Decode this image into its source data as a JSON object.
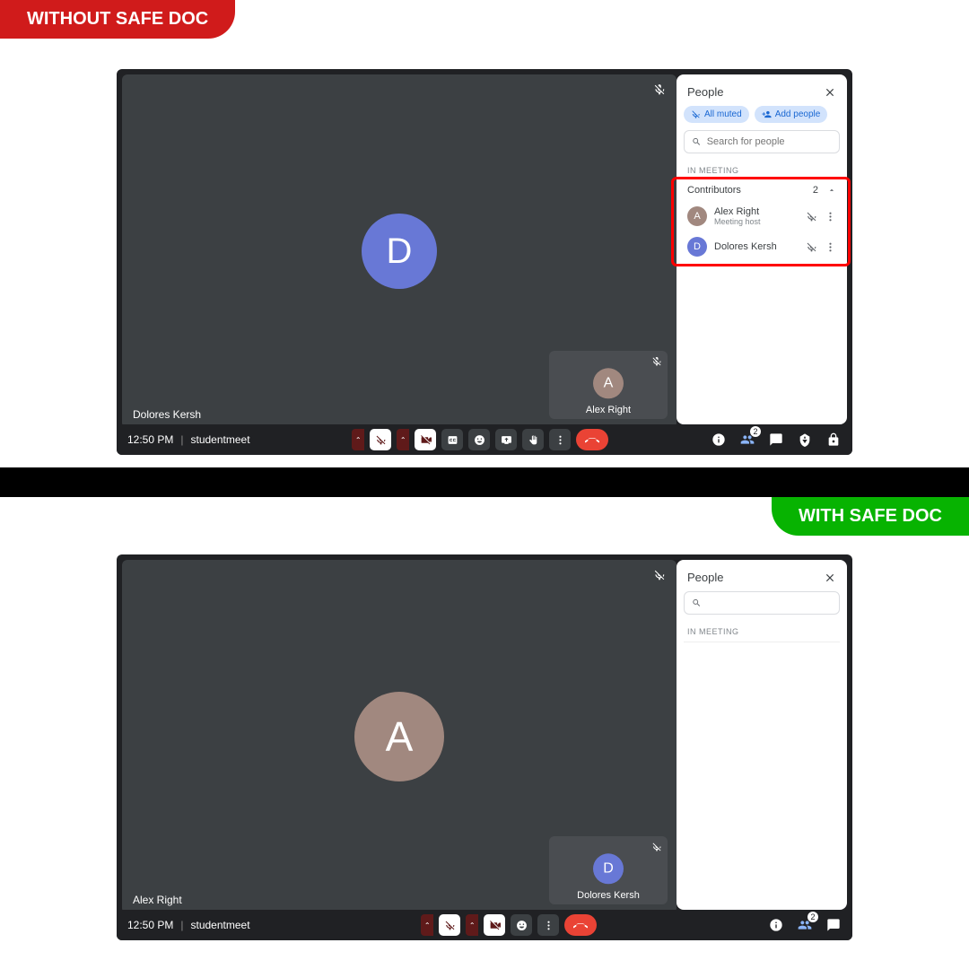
{
  "badges": {
    "without": "WITHOUT SAFE DOC",
    "with": "WITH SAFE DOC"
  },
  "meet1": {
    "main_avatar": "D",
    "main_name": "Dolores Kersh",
    "self_avatar": "A",
    "self_name": "Alex Right",
    "time": "12:50 PM",
    "code": "studentmeet",
    "people_badge": "2",
    "panel": {
      "title": "People",
      "chip_all_muted": "All muted",
      "chip_add_people": "Add people",
      "search_placeholder": "Search for people",
      "section_label": "IN MEETING",
      "contributors_label": "Contributors",
      "contributors_count": "2",
      "persons": [
        {
          "avatar": "A",
          "avatar_class": "A",
          "name": "Alex Right",
          "sub": "Meeting host"
        },
        {
          "avatar": "D",
          "avatar_class": "D",
          "name": "Dolores Kersh",
          "sub": ""
        }
      ]
    }
  },
  "meet2": {
    "main_avatar": "A",
    "main_name": "Alex Right",
    "self_avatar": "D",
    "self_name": "Dolores Kersh",
    "time": "12:50 PM",
    "code": "studentmeet",
    "people_badge": "2",
    "panel": {
      "title": "People",
      "section_label": "IN MEETING"
    }
  }
}
